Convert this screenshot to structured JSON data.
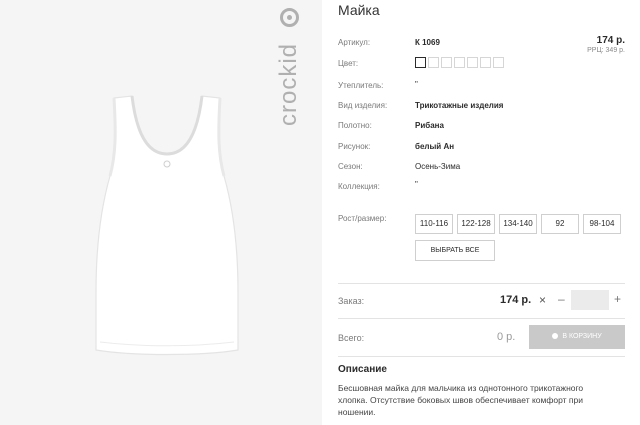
{
  "brand": {
    "logo_text": "crockid"
  },
  "product": {
    "title": "Майка",
    "price": "174 р.",
    "rrp": "РРЦ: 349 р."
  },
  "attributes": [
    {
      "label": "Артикул:",
      "value": "К 1069"
    },
    {
      "label": "Цвет:",
      "value": ""
    },
    {
      "label": "Утеплитель:",
      "value": "\""
    },
    {
      "label": "Вид изделия:",
      "value": "Трикотажные изделия"
    },
    {
      "label": "Полотно:",
      "value": "Рибана"
    },
    {
      "label": "Рисунок:",
      "value": "белый Ан"
    },
    {
      "label": "Сезон:",
      "value": "Осень-Зима"
    },
    {
      "label": "Коллекция:",
      "value": "\""
    }
  ],
  "colors": {
    "swatch_count": 7,
    "selected_index": 0
  },
  "sizes": {
    "label": "Рост/размер:",
    "options": [
      "110-116",
      "122-128",
      "134-140",
      "92",
      "98-104"
    ],
    "select_all": "ВЫБРАТЬ ВСЕ"
  },
  "order": {
    "label": "Заказ:",
    "price": "174 р.",
    "times": "×",
    "minus": "–",
    "plus": "+",
    "qty": ""
  },
  "total": {
    "label": "Всего:",
    "value": "0 р.",
    "cart_button": "В КОРЗИНУ"
  },
  "description": {
    "title": "Описание",
    "text": "Бесшовная майка для мальчика из однотонного трикотажного хлопка. Отсутствие боковых швов обеспечивает комфорт при ношении."
  },
  "colors_theme": {
    "accent_button": "#c9c9c9",
    "photo_bg": "#f5f5f5"
  }
}
